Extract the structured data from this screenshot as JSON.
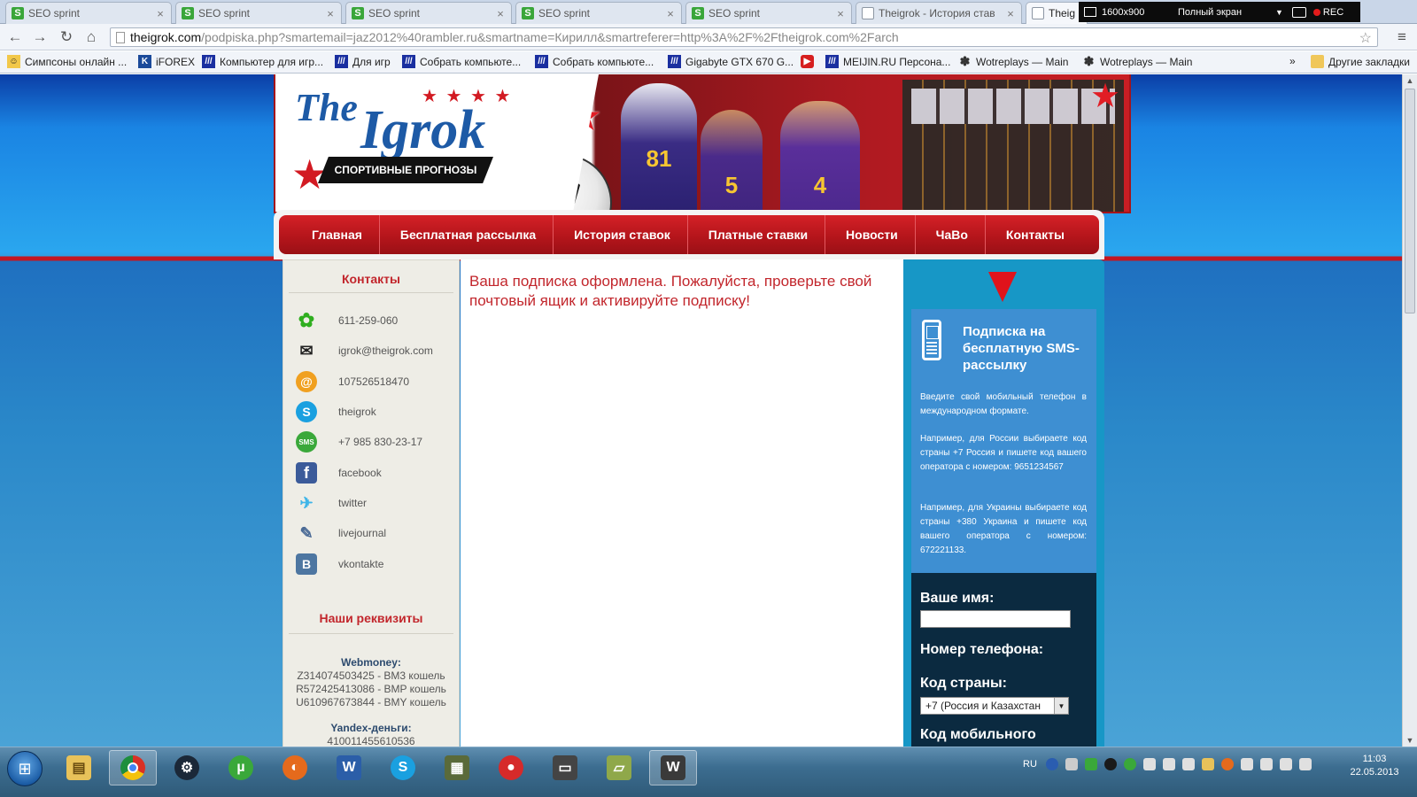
{
  "browser": {
    "tabs": [
      {
        "label": "SEO sprint",
        "icon": "seo-sprint-icon"
      },
      {
        "label": "SEO sprint",
        "icon": "seo-sprint-icon"
      },
      {
        "label": "SEO sprint",
        "icon": "seo-sprint-icon"
      },
      {
        "label": "SEO sprint",
        "icon": "seo-sprint-icon"
      },
      {
        "label": "SEO sprint",
        "icon": "seo-sprint-icon"
      },
      {
        "label": "Theigrok - История став",
        "icon": "page-icon"
      },
      {
        "label": "Theig",
        "icon": "page-icon"
      }
    ],
    "recorder": {
      "resolution": "1600x900",
      "mode": "Полный экран",
      "rec": "REC"
    },
    "url_host": "theigrok.com",
    "url_path": "/podpiska.php?smartemail=jaz2012%40rambler.ru&smartname=Кирилл&smartreferer=http%3A%2F%2Ftheigrok.com%2Farch",
    "bookmarks": [
      {
        "label": "Симпсоны онлайн ...",
        "icon": "page-icon",
        "color": "#888888"
      },
      {
        "label": "iFOREX",
        "icon": "iforex-icon",
        "color": "#1b4a9a"
      },
      {
        "label": "Компьютер для игр...",
        "icon": "site-icon",
        "color": "#1a2fa0"
      },
      {
        "label": "Для игр",
        "icon": "site-icon",
        "color": "#1a2fa0"
      },
      {
        "label": "Собрать компьюте...",
        "icon": "site-icon",
        "color": "#1a2fa0"
      },
      {
        "label": "Собрать компьюте...",
        "icon": "site-icon",
        "color": "#1a2fa0"
      },
      {
        "label": "Gigabyte GTX 670 G...",
        "icon": "site-icon",
        "color": "#1a2fa0"
      },
      {
        "label": "",
        "icon": "youtube-icon",
        "color": "#d61f1f"
      },
      {
        "label": "MEIJIN.RU Персона...",
        "icon": "site-icon",
        "color": "#1a2fa0"
      },
      {
        "label": "Wotreplays — Main",
        "icon": "wotreplays-icon",
        "color": "#333333"
      },
      {
        "label": "Wotreplays — Main",
        "icon": "wotreplays-icon",
        "color": "#333333"
      }
    ],
    "bookmarks_more": "»",
    "other_bookmarks": "Другие закладки"
  },
  "site": {
    "logo_the": "The",
    "logo_igrok": "Igrok",
    "logo_tagline": "СПОРТИВНЫЕ ПРОГНОЗЫ",
    "jersey_numbers": [
      "81",
      "5",
      "4"
    ],
    "menu": [
      "Главная",
      "Бесплатная рассылка",
      "История ставок",
      "Платные ставки",
      "Новости",
      "ЧаВо",
      "Контакты"
    ],
    "contacts_title": "Контакты",
    "contacts": [
      {
        "text": "611-259-060",
        "icon": "icq-icon",
        "color": "#2fae1f",
        "glyph": "✿"
      },
      {
        "text": "igrok@theigrok.com",
        "icon": "envelope-icon",
        "color": "#ffffff",
        "glyph": "✉"
      },
      {
        "text": "107526518470",
        "icon": "mail-agent-icon",
        "color": "#f0a020",
        "glyph": "@"
      },
      {
        "text": "theigrok",
        "icon": "skype-icon",
        "color": "#1aa0e0",
        "glyph": "S"
      },
      {
        "text": "+7 985 830-23-17",
        "icon": "sms-icon",
        "color": "#3aa83a",
        "glyph": "SMS"
      },
      {
        "text": "facebook",
        "icon": "facebook-icon",
        "color": "#3b5b9a",
        "glyph": "f"
      },
      {
        "text": "twitter",
        "icon": "twitter-icon",
        "color": "#3fb5e8",
        "glyph": "t"
      },
      {
        "text": "livejournal",
        "icon": "livejournal-icon",
        "color": "#8aa2c0",
        "glyph": "✎"
      },
      {
        "text": "vkontakte",
        "icon": "vkontakte-icon",
        "color": "#4d76a1",
        "glyph": "B"
      }
    ],
    "requisites_title": "Наши реквизиты",
    "webmoney_label": "Webmoney:",
    "webmoney": [
      "Z314074503425 - BM3 кошель",
      "R572425413086 - BMP кошель",
      "U610967673844 - BMY кошель"
    ],
    "yandex_label": "Yandex-деньги:",
    "yandex_value": "410011455610536",
    "message": "Ваша подписка оформлена. Пожалуйста, проверьте свой почтовый ящик и активируйте подписку!",
    "sms": {
      "title": "Подписка на бесплатную SMS-рассылку",
      "p1": "Введите свой мобильный телефон в международном формате.",
      "p2": "Например, для России выбираете код страны +7 Россия и пишете код вашего оператора с номером: 9651234567",
      "p3": "Например, для Украины выбираете код страны +380 Украина и пишете код вашего оператора с номером: 672221133."
    },
    "form": {
      "name_label": "Ваше имя:",
      "phone_label": "Номер телефона:",
      "country_label": "Код страны:",
      "country_value": "+7 (Россия и Казахстан",
      "mobile_label": "Код мобильного"
    }
  },
  "taskbar": {
    "apps": [
      {
        "name": "explorer-icon",
        "color": "#e8c25a",
        "glyph": "▤"
      },
      {
        "name": "chrome-icon",
        "color": "#3c8f3c",
        "glyph": "◉"
      },
      {
        "name": "steam-icon",
        "color": "#1b2838",
        "glyph": "⚙"
      },
      {
        "name": "utorrent-icon",
        "color": "#3aa83a",
        "glyph": "µ"
      },
      {
        "name": "firefox-icon",
        "color": "#e56a1c",
        "glyph": "◐"
      },
      {
        "name": "word-icon",
        "color": "#2b5ea8",
        "glyph": "W"
      },
      {
        "name": "skype-icon",
        "color": "#1aa0e0",
        "glyph": "S"
      },
      {
        "name": "screen-recorder-icon",
        "color": "#5a6a3a",
        "glyph": "▦"
      },
      {
        "name": "record-icon",
        "color": "#d62a2a",
        "glyph": "●"
      },
      {
        "name": "monitor-icon",
        "color": "#444444",
        "glyph": "▭"
      },
      {
        "name": "notes-icon",
        "color": "#8fa84a",
        "glyph": "▱"
      },
      {
        "name": "world-of-tanks-icon",
        "color": "#3a3a3a",
        "glyph": "W"
      }
    ],
    "lang": "RU",
    "time": "11:03",
    "date": "22.05.2013"
  }
}
